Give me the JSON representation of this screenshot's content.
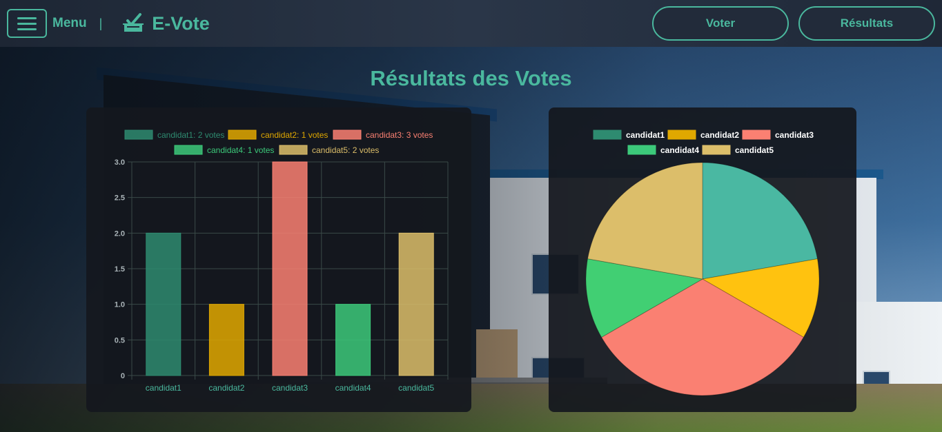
{
  "navbar": {
    "menu_label": "Menu",
    "separator": "|",
    "app_title": "E-Vote",
    "buttons": {
      "vote": "Voter",
      "results": "Résultats"
    }
  },
  "page": {
    "title": "Résultats des Votes"
  },
  "colors": {
    "accent": "#4ab89e",
    "candidat1": "#2e8b70",
    "candidat2": "#e0a800",
    "candidat3": "#fa8072",
    "candidat4": "#3cc97a",
    "candidat5": "#dcbe6a"
  },
  "chart_data": [
    {
      "type": "bar",
      "categories": [
        "candidat1",
        "candidat2",
        "candidat3",
        "candidat4",
        "candidat5"
      ],
      "values": [
        2,
        1,
        3,
        1,
        2
      ],
      "legend": [
        "candidat1: 2 votes",
        "candidat2: 1 votes",
        "candidat3: 3 votes",
        "candidat4: 1 votes",
        "candidat5: 2 votes"
      ],
      "ylim": [
        0,
        3
      ],
      "yticks": [
        "0",
        "0.5",
        "1.0",
        "1.5",
        "2.0",
        "2.5",
        "3.0"
      ],
      "legend_position": "top",
      "grid": true
    },
    {
      "type": "pie",
      "categories": [
        "candidat1",
        "candidat2",
        "candidat3",
        "candidat4",
        "candidat5"
      ],
      "values": [
        2,
        1,
        3,
        1,
        2
      ],
      "legend": [
        "candidat1",
        "candidat2",
        "candidat3",
        "candidat4",
        "candidat5"
      ],
      "legend_position": "top"
    }
  ]
}
